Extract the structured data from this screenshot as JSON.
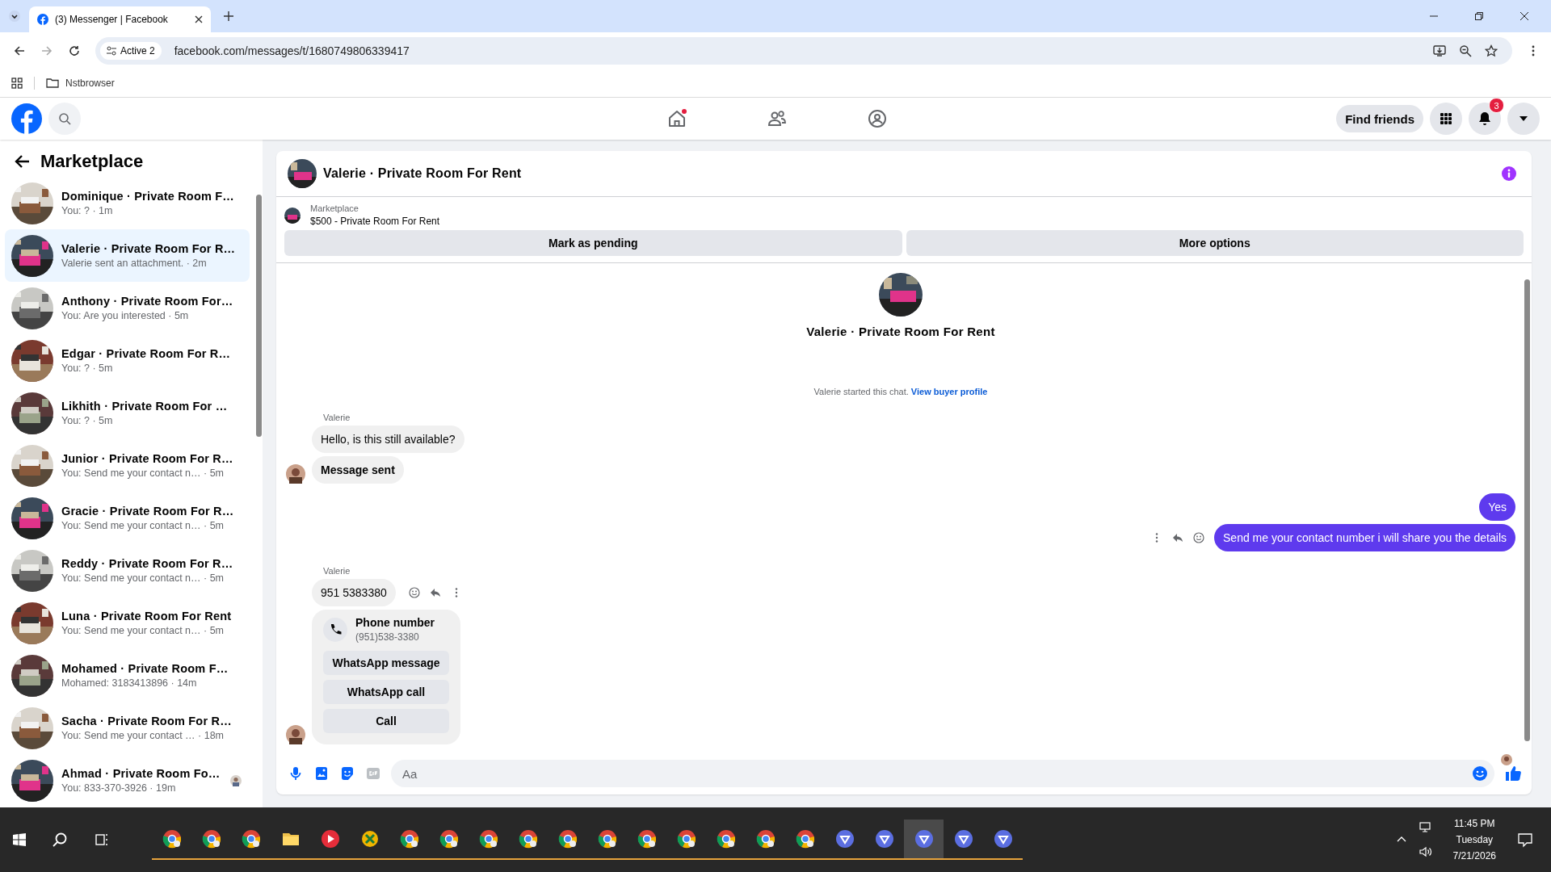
{
  "browser": {
    "tab_title": "(3) Messenger | Facebook",
    "profile": "Active 2",
    "url": "facebook.com/messages/t/1680749806339417",
    "bookmark": "Nstbrowser"
  },
  "header": {
    "find_friends": "Find friends",
    "notification_count": "3"
  },
  "sidebar": {
    "title": "Marketplace",
    "conversations": [
      {
        "name": "Dominique · Private Room F…",
        "preview": "You: ? · 1m",
        "selected": false,
        "seen": false
      },
      {
        "name": "Valerie · Private Room For R…",
        "preview": "Valerie sent an attachment. · 2m",
        "selected": true,
        "seen": false
      },
      {
        "name": "Anthony · Private Room For…",
        "preview": "You: Are you interested · 5m",
        "selected": false,
        "seen": false
      },
      {
        "name": "Edgar · Private Room For R…",
        "preview": "You: ? · 5m",
        "selected": false,
        "seen": false
      },
      {
        "name": "Likhith · Private Room For …",
        "preview": "You: ? · 5m",
        "selected": false,
        "seen": false
      },
      {
        "name": "Junior · Private Room For R…",
        "preview": "You: Send me your contact n… · 5m",
        "selected": false,
        "seen": false
      },
      {
        "name": "Gracie · Private Room For R…",
        "preview": "You: Send me your contact n… · 5m",
        "selected": false,
        "seen": false
      },
      {
        "name": "Reddy · Private Room For R…",
        "preview": "You: Send me your contact n… · 5m",
        "selected": false,
        "seen": false
      },
      {
        "name": "Luna · Private Room For Rent",
        "preview": "You: Send me your contact n… · 5m",
        "selected": false,
        "seen": false
      },
      {
        "name": "Mohamed · Private Room F…",
        "preview": "Mohamed: 3183413896 · 14m",
        "selected": false,
        "seen": false
      },
      {
        "name": "Sacha · Private Room For R…",
        "preview": "You: Send me your contact … · 18m",
        "selected": false,
        "seen": false
      },
      {
        "name": "Ahmad · Private Room Fo…",
        "preview": "You: 833-370-3926 · 19m",
        "selected": false,
        "seen": true
      }
    ]
  },
  "chat": {
    "title": "Valerie · Private Room For Rent",
    "listing": {
      "label": "Marketplace",
      "title": "$500 - Private Room For Rent"
    },
    "actions": [
      "Mark as pending",
      "More options"
    ],
    "intro_name": "Valerie · Private Room For Rent",
    "started_text": "Valerie started this chat.",
    "profile_link": "View buyer profile",
    "messages": [
      {
        "kind": "sender",
        "text": "Valerie"
      },
      {
        "kind": "incoming",
        "text": "Hello, is this still available?",
        "bold": false,
        "avatar": false,
        "actions": false
      },
      {
        "kind": "incoming",
        "text": "Message sent",
        "bold": true,
        "avatar": true,
        "actions": false
      },
      {
        "kind": "outgoing",
        "text": "Yes",
        "actions": false
      },
      {
        "kind": "outgoing",
        "text": "Send me your contact number i will share you the details",
        "actions": true
      },
      {
        "kind": "sender",
        "text": "Valerie"
      },
      {
        "kind": "incoming",
        "text": "951 5383380",
        "bold": false,
        "avatar": false,
        "actions": true
      },
      {
        "kind": "contact",
        "title": "Phone number",
        "subtitle": "(951)538-3380",
        "buttons": [
          "WhatsApp message",
          "WhatsApp call",
          "Call"
        ],
        "avatar": true
      }
    ],
    "composer": {
      "placeholder": "Aa"
    }
  },
  "taskbar": {
    "time": "11:45 PM",
    "day": "Tuesday",
    "date": "7/21/2026"
  }
}
